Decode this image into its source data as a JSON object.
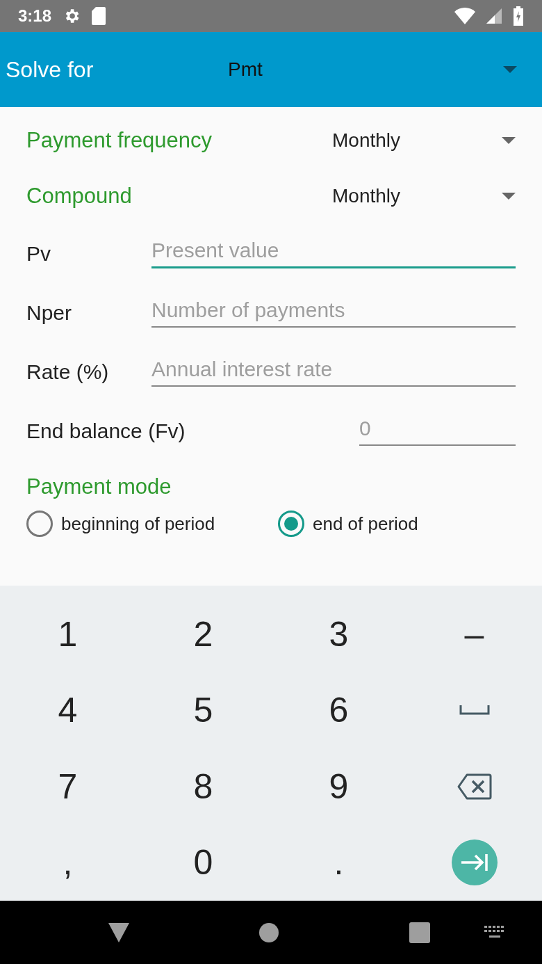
{
  "status_bar": {
    "time": "3:18"
  },
  "app_bar": {
    "label": "Solve for",
    "value": "Pmt"
  },
  "dropdowns": [
    {
      "label": "Payment frequency",
      "value": "Monthly"
    },
    {
      "label": "Compound",
      "value": "Monthly"
    }
  ],
  "fields": [
    {
      "label": "Pv",
      "placeholder": "Present value",
      "focused": true,
      "kind": "wide"
    },
    {
      "label": "Nper",
      "placeholder": "Number of payments",
      "focused": false,
      "kind": "wide"
    },
    {
      "label": "Rate (%)",
      "placeholder": "Annual interest rate",
      "focused": false,
      "kind": "wide"
    },
    {
      "label": "End balance (Fv)",
      "placeholder": "0",
      "focused": false,
      "kind": "narrow"
    }
  ],
  "payment_mode": {
    "label": "Payment mode",
    "options": [
      {
        "label": "beginning of period",
        "selected": false
      },
      {
        "label": "end of period",
        "selected": true
      }
    ]
  },
  "keyboard": {
    "rows": [
      [
        {
          "kind": "text",
          "label": "1"
        },
        {
          "kind": "text",
          "label": "2"
        },
        {
          "kind": "text",
          "label": "3"
        },
        {
          "kind": "text",
          "label": "–"
        }
      ],
      [
        {
          "kind": "text",
          "label": "4"
        },
        {
          "kind": "text",
          "label": "5"
        },
        {
          "kind": "text",
          "label": "6"
        },
        {
          "kind": "space"
        }
      ],
      [
        {
          "kind": "text",
          "label": "7"
        },
        {
          "kind": "text",
          "label": "8"
        },
        {
          "kind": "text",
          "label": "9"
        },
        {
          "kind": "backspace"
        }
      ],
      [
        {
          "kind": "text",
          "label": ","
        },
        {
          "kind": "text",
          "label": "0"
        },
        {
          "kind": "text",
          "label": "."
        },
        {
          "kind": "next"
        }
      ]
    ]
  }
}
